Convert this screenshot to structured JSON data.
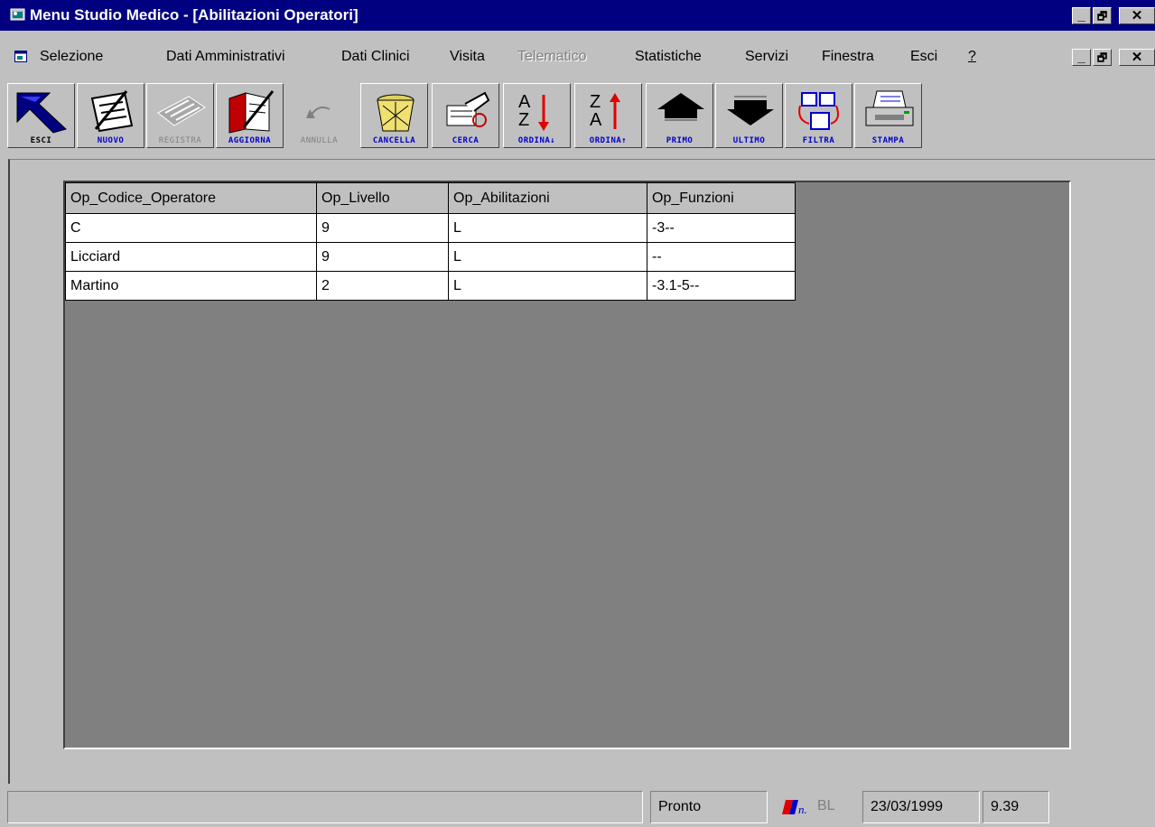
{
  "window": {
    "title": "Menu Studio Medico - [Abilitazioni Operatori]",
    "controls": [
      "_",
      "🗗",
      "✕"
    ]
  },
  "menu": [
    {
      "label": "Selezione",
      "enabled": true
    },
    {
      "label": "Dati Amministrativi",
      "enabled": true
    },
    {
      "label": "Dati Clinici",
      "enabled": true
    },
    {
      "label": "Visita",
      "enabled": true
    },
    {
      "label": "Telematico",
      "enabled": false
    },
    {
      "label": "Statistiche",
      "enabled": true
    },
    {
      "label": "Servizi",
      "enabled": true
    },
    {
      "label": "Finestra",
      "enabled": true
    },
    {
      "label": "Esci",
      "enabled": true
    },
    {
      "label": "?",
      "enabled": true
    }
  ],
  "toolbar": [
    {
      "label": "ESCI",
      "icon": "exit-arrow-icon",
      "enabled": true
    },
    {
      "label": "NUOVO",
      "icon": "new-document-icon",
      "enabled": true
    },
    {
      "label": "REGISTRA",
      "icon": "save-record-icon",
      "enabled": false
    },
    {
      "label": "AGGIORNA",
      "icon": "update-book-icon",
      "enabled": true
    },
    {
      "label": "ANNULLA",
      "icon": "undo-icon",
      "enabled": false
    },
    {
      "label": "CANCELLA",
      "icon": "trash-basket-icon",
      "enabled": true
    },
    {
      "label": "CERCA",
      "icon": "search-hand-icon",
      "enabled": true
    },
    {
      "label": "ORDINA↓",
      "icon": "sort-ascending-icon",
      "enabled": true
    },
    {
      "label": "ORDINA↑",
      "icon": "sort-descending-icon",
      "enabled": true
    },
    {
      "label": "PRIMO",
      "icon": "first-record-icon",
      "enabled": true
    },
    {
      "label": "ULTIMO",
      "icon": "last-record-icon",
      "enabled": true
    },
    {
      "label": "FILTRA",
      "icon": "filter-icon",
      "enabled": true
    },
    {
      "label": "STAMPA",
      "icon": "printer-icon",
      "enabled": true
    }
  ],
  "grid": {
    "columns": [
      "Op_Codice_Operatore",
      "Op_Livello",
      "Op_Abilitazioni",
      "Op_Funzioni"
    ],
    "rows": [
      [
        "C",
        "9",
        "L",
        "-3--"
      ],
      [
        "Licciard",
        "9",
        "L",
        "--"
      ],
      [
        "Martino",
        "2",
        "L",
        "-3.1-5--"
      ]
    ]
  },
  "status": {
    "message": "Pronto",
    "mode": "BL",
    "date": "23/03/1999",
    "time": "9.39"
  },
  "colors": {
    "titlebar": "#000080",
    "face": "#c0c0c0",
    "workspace": "#808080",
    "toolbar_label": "#0000cc"
  }
}
